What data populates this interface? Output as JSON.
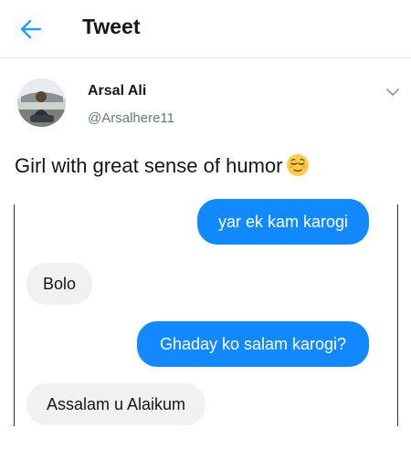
{
  "header": {
    "title": "Tweet",
    "back_icon": "arrow-left-icon",
    "accent": "#1da1f2"
  },
  "tweet": {
    "author_name": "Arsal Ali",
    "handle": "@Arsalhere11",
    "text": "Girl with great sense of humor",
    "emoji": "relieved-face-emoji",
    "menu_icon": "chevron-down-icon"
  },
  "chat": {
    "messages": [
      {
        "side": "sent",
        "text": "yar ek kam karogi"
      },
      {
        "side": "received",
        "text": "Bolo"
      },
      {
        "side": "sent",
        "text": "Ghaday ko salam karogi?"
      },
      {
        "side": "received",
        "text": "Assalam u Alaikum"
      }
    ],
    "sent_color": "#1289fe",
    "received_color": "#f1f1f1"
  }
}
